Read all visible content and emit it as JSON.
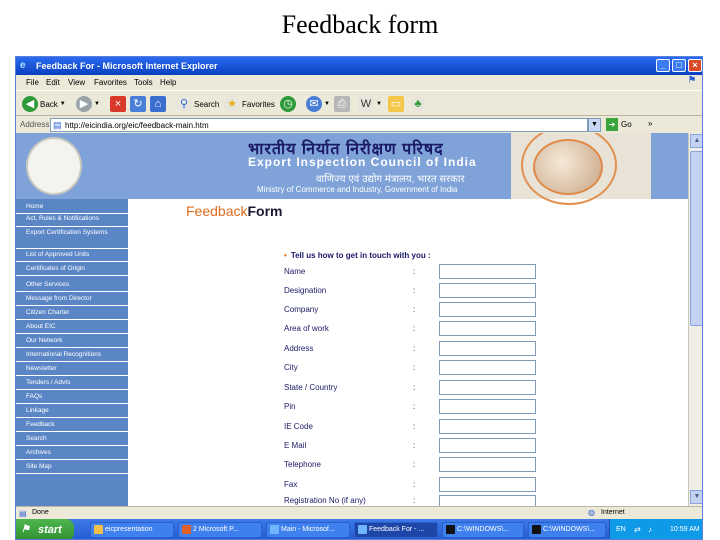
{
  "slide": {
    "title": "Feedback form"
  },
  "window": {
    "title": "Feedback For - Microsoft Internet Explorer"
  },
  "menu": [
    "File",
    "Edit",
    "View",
    "Favorites",
    "Tools",
    "Help"
  ],
  "toolbar": {
    "back": "Back",
    "search": "Search",
    "favorites": "Favorites"
  },
  "address": {
    "label": "Address",
    "url": "http://eicindia.org/eic/feedback-main.htm",
    "go": "Go",
    "links": "»"
  },
  "banner": {
    "hindi_title": "भारतीय निर्यात निरीक्षण परिषद",
    "council": "Export Inspection Council of India",
    "ministry_hindi": "वाणिज्य एवं उद्योग मंत्रालय, भारत सरकार",
    "ministry": "Ministry of Commerce and Industry, Government of India"
  },
  "nav": [
    "Home",
    "Act, Rules & Notifications",
    "Export Certification Systems",
    "List of Approved Units",
    "Certificates of Origin",
    "Other Services",
    "Message from Director",
    "Citizen Charter",
    "About EIC",
    "Our Network",
    "International Recognitions",
    "Newsletter",
    "Tenders / Advts",
    "FAQs",
    "Linkage",
    "Feedback",
    "Search",
    "Archives",
    "Site Map"
  ],
  "form": {
    "title_part1": "Feedback",
    "title_part2": "Form",
    "section": "Tell us how to get in touch with you :",
    "fields": [
      "Name",
      "Designation",
      "Company",
      "Area of work",
      "Address",
      "City",
      "State / Country",
      "Pin",
      "IE Code",
      "E Mail",
      "Telephone",
      "Fax",
      "Registration No (if any)"
    ],
    "colon": ":"
  },
  "status": {
    "left": "Done",
    "zone": "Internet"
  },
  "taskbar": {
    "start": "start",
    "tasks": [
      "eicpresentation",
      "2 Microsoft P...",
      "Main - Microsof...",
      "Feedback For - ...",
      "C:\\WINDOWS\\...",
      "C:\\WINDOWS\\..."
    ],
    "lang": "EN",
    "time": "10:59 AM"
  },
  "colors": {
    "nav_bg": "#5b86c6",
    "banner_bg": "#7fa3d8",
    "accent": "#e06b1a"
  }
}
